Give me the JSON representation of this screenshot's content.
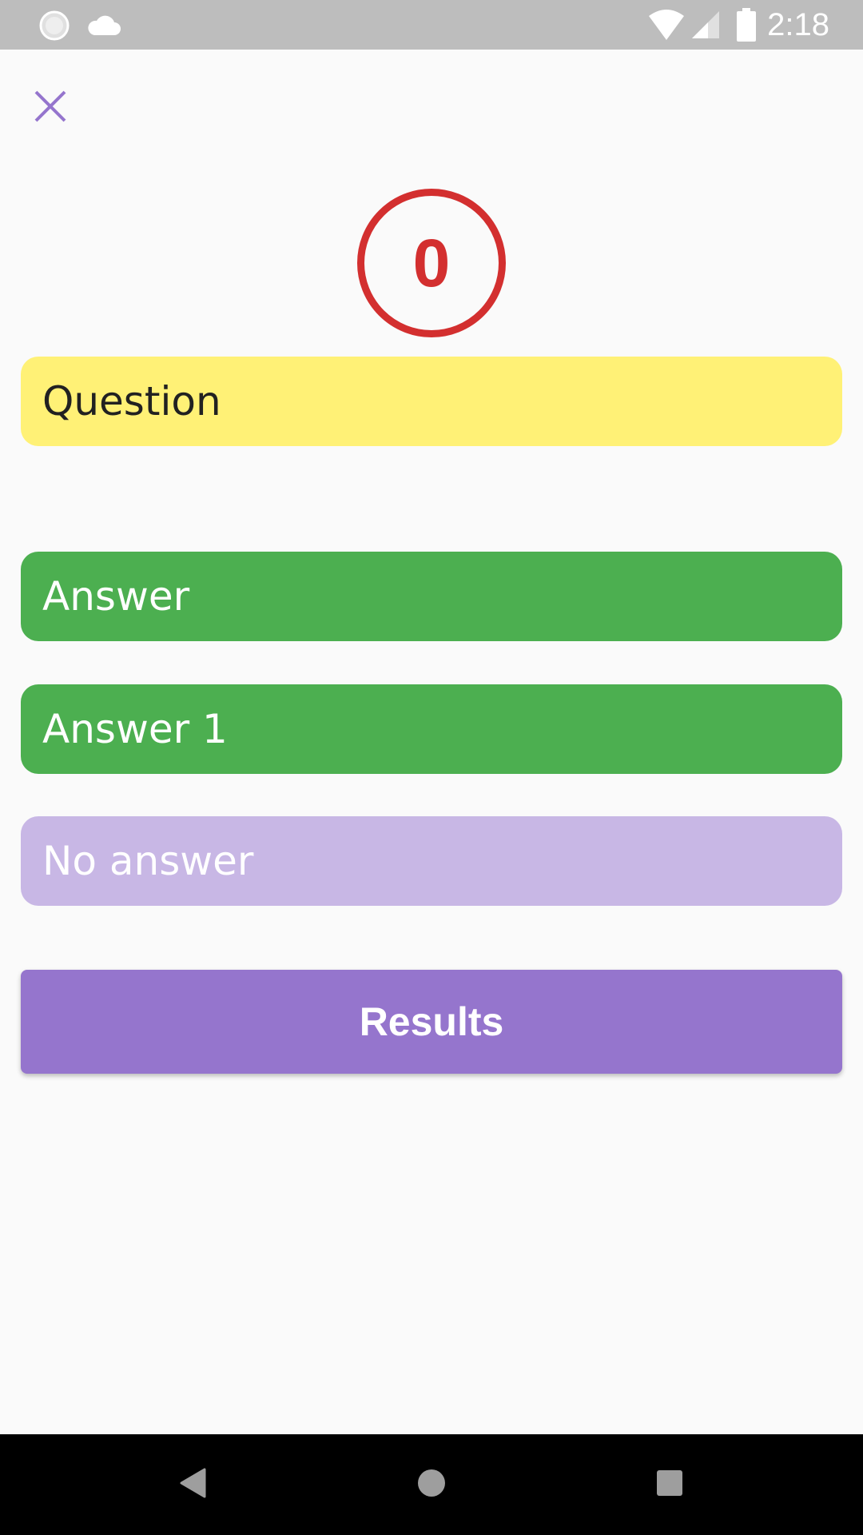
{
  "status_bar": {
    "time": "2:18",
    "icons": [
      "sync-icon",
      "cloud-icon",
      "wifi-icon",
      "signal-icon",
      "battery-icon"
    ]
  },
  "toolbar": {
    "close_icon": "close-icon"
  },
  "score": {
    "value": "0"
  },
  "question": {
    "text": "Question"
  },
  "answers": [
    {
      "label": "Answer"
    },
    {
      "label": "Answer 1"
    }
  ],
  "no_answer": {
    "label": "No answer"
  },
  "results_button": {
    "label": "Results"
  },
  "nav_bar": {
    "icons": [
      "back-icon",
      "home-icon",
      "recents-icon"
    ]
  },
  "colors": {
    "status_bar": "#bdbdbd",
    "accent": "#9575cd",
    "score_red": "#d32f2f",
    "question_yellow": "#fff176",
    "answer_green": "#4caf50",
    "no_answer_lavender": "#c8b7e5",
    "background": "#fafafa"
  }
}
